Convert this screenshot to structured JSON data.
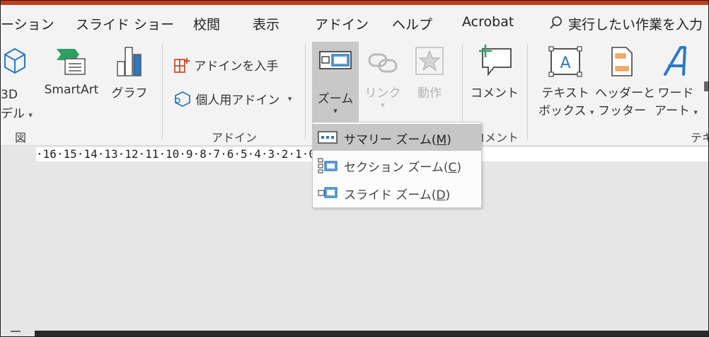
{
  "tabs": [
    "ーション",
    "スライド ショー",
    "校閲",
    "表示",
    "アドイン",
    "ヘルプ",
    "Acrobat"
  ],
  "tell_me": "実行したい作業を入力",
  "ribbon": {
    "model3d": [
      "3D",
      "デル"
    ],
    "smartart": "SmartArt",
    "graph": "グラフ",
    "get_addins": "アドインを入手",
    "my_addins": "個人用アドイン",
    "zoom": "ズーム",
    "link": "リンク",
    "action": "動作",
    "comment": "コメント",
    "textbox": [
      "テキスト",
      "ボックス"
    ],
    "header_footer": [
      "ヘッダーと",
      "フッター"
    ],
    "wordart": [
      "ワード",
      "アート"
    ],
    "groups": {
      "illustrations": "図",
      "addins": "アドイン",
      "comments": "コメント",
      "text": "テキ"
    }
  },
  "ruler_text": "·16·15·14·13·12·11·10·9·8·7·6·5·4·3·2·1·0·1·2·3·4·5·6·7·8·",
  "menu": {
    "items": [
      {
        "label": "サマリー ズーム(",
        "key": "M",
        "close": ")"
      },
      {
        "label": "セクション ズーム(",
        "key": "C",
        "close": ")"
      },
      {
        "label": "スライド ズーム(",
        "key": "D",
        "close": ")"
      }
    ]
  },
  "colors": {
    "accent": "#c43e1c",
    "icon_blue": "#2b79c2",
    "icon_green": "#2e9e62",
    "icon_orange": "#e8872e",
    "selected": "#c6c6c6"
  }
}
